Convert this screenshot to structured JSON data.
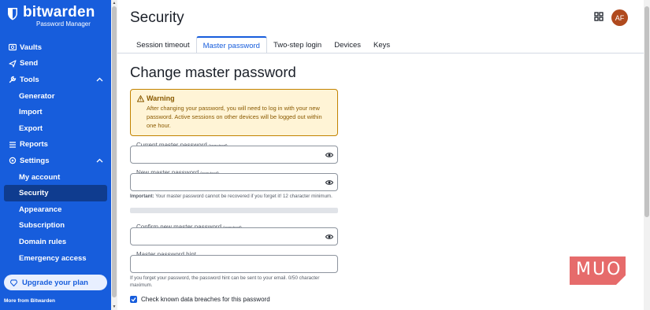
{
  "sidebar": {
    "logo_word": "bitwarden",
    "logo_sub": "Password Manager",
    "items": [
      {
        "label": "Vaults",
        "icon": "vault-icon"
      },
      {
        "label": "Send",
        "icon": "send-icon"
      },
      {
        "label": "Tools",
        "icon": "wrench-icon"
      },
      {
        "label": "Generator"
      },
      {
        "label": "Import"
      },
      {
        "label": "Export"
      },
      {
        "label": "Reports",
        "icon": "list-icon"
      },
      {
        "label": "Settings",
        "icon": "gear-icon"
      },
      {
        "label": "My account"
      },
      {
        "label": "Security"
      },
      {
        "label": "Appearance"
      },
      {
        "label": "Subscription"
      },
      {
        "label": "Domain rules"
      },
      {
        "label": "Emergency access"
      }
    ],
    "upgrade_label": "Upgrade your plan",
    "more_label": "More from Bitwarden"
  },
  "header": {
    "title": "Security",
    "avatar_initials": "AF"
  },
  "tabs": [
    {
      "label": "Session timeout"
    },
    {
      "label": "Master password"
    },
    {
      "label": "Two-step login"
    },
    {
      "label": "Devices"
    },
    {
      "label": "Keys"
    }
  ],
  "form": {
    "heading": "Change master password",
    "warning_title": "Warning",
    "warning_text": "After changing your password, you will need to log in with your new password. Active sessions on other devices will be logged out within one hour.",
    "current_label": "Current master password",
    "new_label": "New master password",
    "required_tag": "(required)",
    "new_hint_bold": "Important:",
    "new_hint_text": " Your master password cannot be recovered if you forget it! 12 character minimum.",
    "confirm_label": "Confirm new master password",
    "hint_label": "Master password hint",
    "hint_help": "If you forget your password, the password hint can be sent to your email. 0/50 character maximum.",
    "breach_check_label": "Check known data breaches for this password"
  },
  "watermark": "MUO",
  "colors": {
    "brand": "#175ddc",
    "sidebar_active": "#0f3c8f",
    "warning_bg": "#fff4d6",
    "warning_border": "#c28200",
    "avatar": "#b04a1e"
  }
}
